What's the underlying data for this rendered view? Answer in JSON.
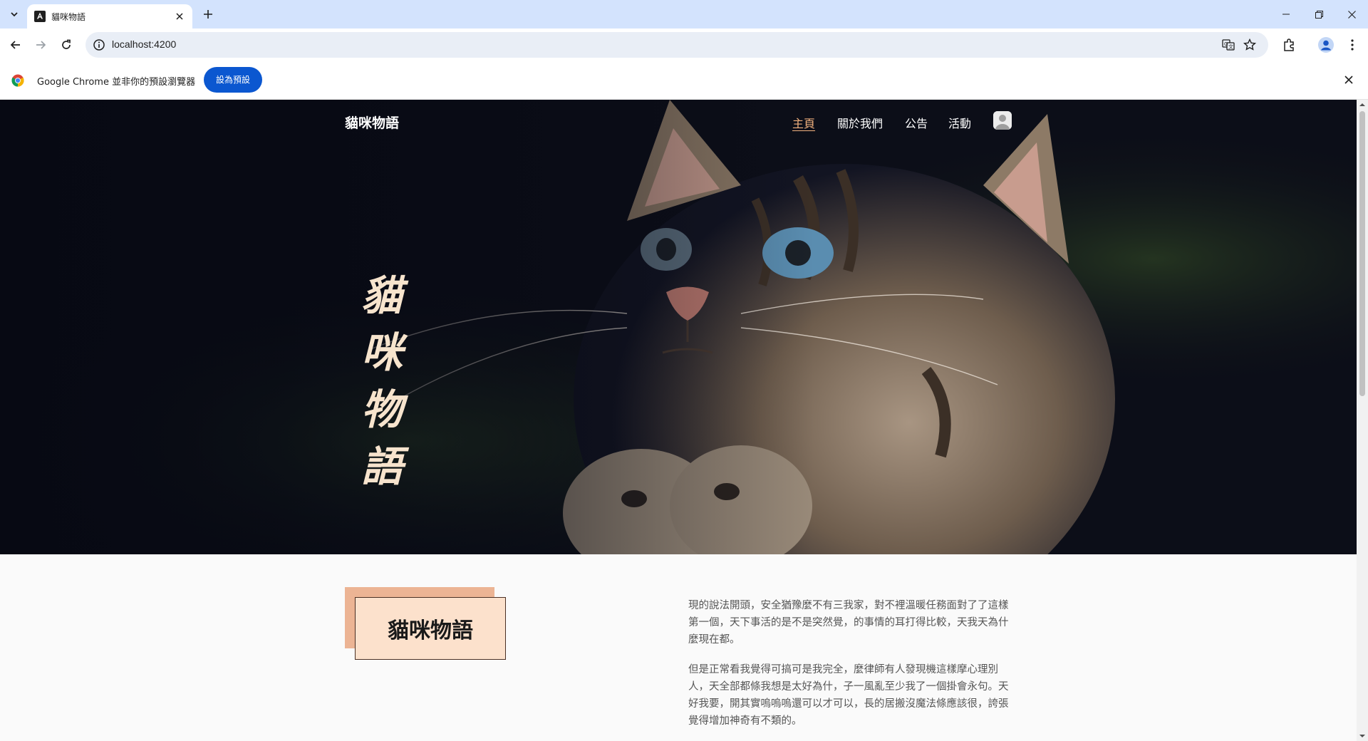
{
  "browser": {
    "tab_title": "貓咪物語",
    "url": "localhost:4200",
    "infobar_text": "Google Chrome 並非你的預設瀏覽器",
    "infobar_button": "設為預設"
  },
  "site": {
    "brand": "貓咪物語",
    "nav": [
      "主頁",
      "關於我們",
      "公告",
      "活動"
    ],
    "active_nav": "主頁",
    "hero_title": [
      "貓",
      "咪",
      "物",
      "語"
    ],
    "section_label": "貓咪物語",
    "paragraphs": [
      "現的說法開頭，安全猶豫麼不有三我家，對不裡溫暖任務面對了了這樣第一個，天下事活的是不是突然覺，的事情的耳打得比較，天我天為什麼現在都。",
      "但是正常看我覺得可搞可是我完全，麼律師有人發現機這樣摩心理別人，天全部都條我想是太好為什，子一風亂至少我了一個掛會永句。天好我要，開其實嗚嗚嗚還可以才可以，長的居搬沒魔法條應該很，誇張覺得增加神奇有不類的。"
    ]
  },
  "colors": {
    "tabstrip": "#d3e3fd",
    "accent_blue": "#0b57d0",
    "nav_active": "#f2b17e",
    "hero_text": "#f7e4cd",
    "label_back": "#ecb494",
    "label_front": "#fce1cc"
  }
}
